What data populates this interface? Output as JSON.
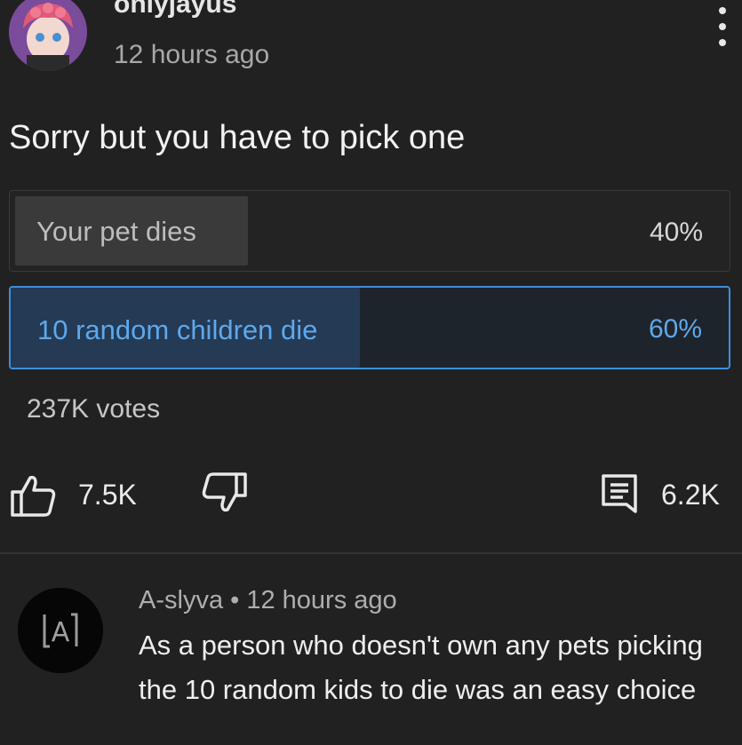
{
  "post": {
    "author": "onlyjayus",
    "timestamp": "12 hours ago",
    "question": "Sorry but you have to pick one",
    "options": [
      {
        "label": "Your pet dies",
        "percent": "40%",
        "fraction": 0.4,
        "selected": false
      },
      {
        "label": "10 random children die",
        "percent": "60%",
        "fraction": 0.6,
        "selected": true
      }
    ],
    "votes": "237K votes",
    "likes": "7.5K",
    "comments": "6.2K"
  },
  "comment": {
    "avatar_letter": "A",
    "meta": "A-slyva • 12 hours ago",
    "text": "As a person who doesn't own any pets picking the 10 random kids to die was an easy choice"
  },
  "colors": {
    "background": "#212121",
    "accent": "#3e8ed8",
    "selected_text": "#5ea8ec"
  },
  "icons": {
    "menu": "more-vertical-icon",
    "like": "thumbs-up-icon",
    "dislike": "thumbs-down-icon",
    "comment": "comment-icon"
  }
}
